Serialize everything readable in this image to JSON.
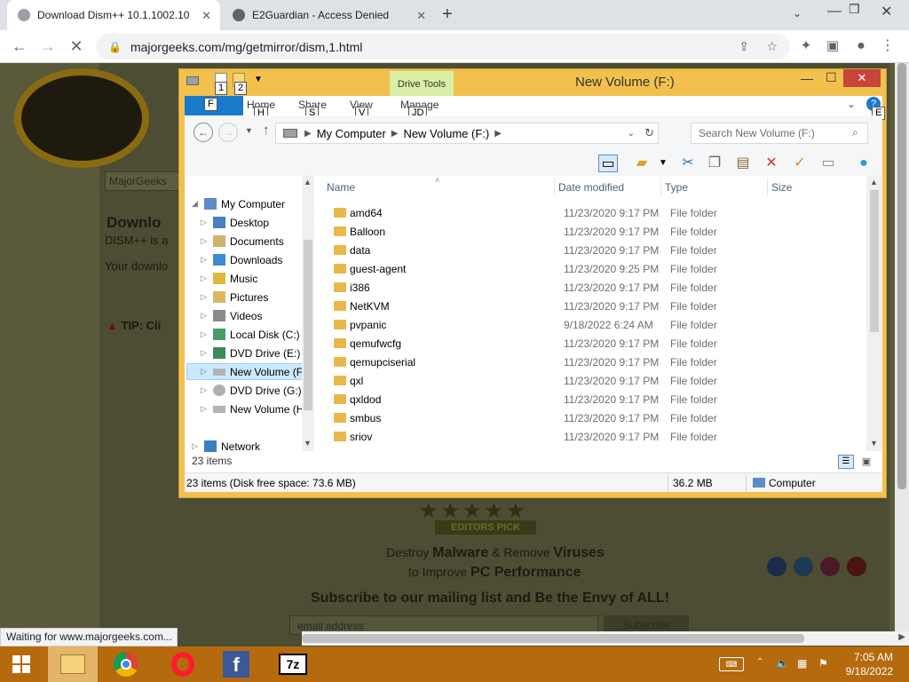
{
  "browser": {
    "tabs": [
      {
        "title": "Download Dism++ 10.1.1002.10",
        "active": true
      },
      {
        "title": "E2Guardian - Access Denied",
        "active": false
      }
    ],
    "url": "majorgeeks.com/mg/getmirror/dism,1.html",
    "load_status": "Waiting for www.majorgeeks.com..."
  },
  "site": {
    "search_placeholder": "MajorGeeks",
    "heading": "Downlo",
    "subtitle": "DISM++ is a",
    "body": "Your downlo",
    "tip": "TIP: Cli",
    "badge": "EDITORS PICK",
    "promo_line1_a": "Destroy ",
    "promo_line1_b": "Malware",
    "promo_line1_c": " & Remove ",
    "promo_line1_d": "Viruses",
    "promo_line2_a": "to Improve ",
    "promo_line2_b": "PC Performance",
    "subscribe": "Subscribe to our mailing list and Be the Envy of ALL!",
    "email_placeholder": "email address",
    "subscribe_btn": "Subscribe"
  },
  "explorer": {
    "title": "New Volume (F:)",
    "context_tab": "Drive Tools",
    "ribbon": {
      "file": "F",
      "tabs": [
        "Home",
        "Share",
        "View",
        "Manage"
      ],
      "keytips": [
        "H",
        "S",
        "V",
        "JD"
      ],
      "qat_keytips": [
        "1",
        "2"
      ],
      "help_keytip": "E"
    },
    "breadcrumb": [
      "My Computer",
      "New Volume (F:)"
    ],
    "search_placeholder": "Search New Volume (F:)",
    "nav": [
      {
        "label": "My Computer",
        "level": 0,
        "expanded": true
      },
      {
        "label": "Desktop",
        "level": 1
      },
      {
        "label": "Documents",
        "level": 1
      },
      {
        "label": "Downloads",
        "level": 1
      },
      {
        "label": "Music",
        "level": 1
      },
      {
        "label": "Pictures",
        "level": 1
      },
      {
        "label": "Videos",
        "level": 1
      },
      {
        "label": "Local Disk (C:)",
        "level": 1
      },
      {
        "label": "DVD Drive (E:)",
        "level": 1
      },
      {
        "label": "New Volume (F:)",
        "level": 1,
        "selected": true
      },
      {
        "label": "DVD Drive (G:)",
        "level": 1
      },
      {
        "label": "New Volume (H:)",
        "level": 1
      },
      {
        "label": "Network",
        "level": 0
      }
    ],
    "columns": [
      "Name",
      "Date modified",
      "Type",
      "Size"
    ],
    "files": [
      {
        "name": "amd64",
        "date": "11/23/2020 9:17 PM",
        "type": "File folder"
      },
      {
        "name": "Balloon",
        "date": "11/23/2020 9:17 PM",
        "type": "File folder"
      },
      {
        "name": "data",
        "date": "11/23/2020 9:17 PM",
        "type": "File folder"
      },
      {
        "name": "guest-agent",
        "date": "11/23/2020 9:25 PM",
        "type": "File folder"
      },
      {
        "name": "i386",
        "date": "11/23/2020 9:17 PM",
        "type": "File folder"
      },
      {
        "name": "NetKVM",
        "date": "11/23/2020 9:17 PM",
        "type": "File folder"
      },
      {
        "name": "pvpanic",
        "date": "9/18/2022 6:24 AM",
        "type": "File folder"
      },
      {
        "name": "qemufwcfg",
        "date": "11/23/2020 9:17 PM",
        "type": "File folder"
      },
      {
        "name": "qemupciserial",
        "date": "11/23/2020 9:17 PM",
        "type": "File folder"
      },
      {
        "name": "qxl",
        "date": "11/23/2020 9:17 PM",
        "type": "File folder"
      },
      {
        "name": "qxldod",
        "date": "11/23/2020 9:17 PM",
        "type": "File folder"
      },
      {
        "name": "smbus",
        "date": "11/23/2020 9:17 PM",
        "type": "File folder"
      },
      {
        "name": "sriov",
        "date": "11/23/2020 9:17 PM",
        "type": "File folder"
      }
    ],
    "item_count": "23 items",
    "status_left": "23 items (Disk free space: 73.6 MB)",
    "status_size": "36.2 MB",
    "status_zone": "Computer"
  },
  "taskbar": {
    "time": "7:05 AM",
    "date": "9/18/2022"
  },
  "colors": {
    "taskbar": "#b56a0e",
    "window_frame": "#f2c14d",
    "accent": "#1979ca"
  }
}
